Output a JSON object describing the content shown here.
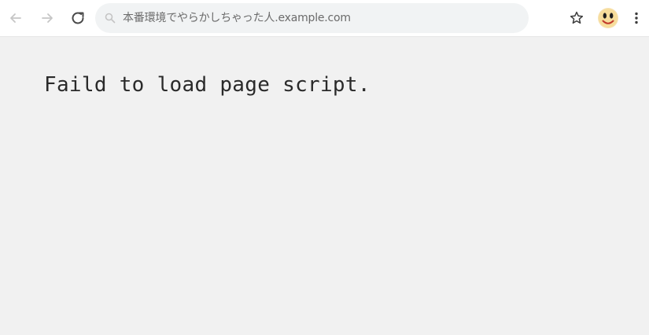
{
  "toolbar": {
    "back_icon": "arrow-left-icon",
    "forward_icon": "arrow-right-icon",
    "reload_icon": "reload-icon",
    "address": {
      "url": "本番環境でやらかしちゃった人.example.com",
      "icon": "search-icon"
    },
    "bookmark_icon": "star-outline-icon",
    "profile_icon": "smiley-avatar-icon",
    "menu_icon": "vertical-dots-icon"
  },
  "page": {
    "error_message": "Faild to load page script."
  },
  "colors": {
    "toolbar_bg": "#ffffff",
    "omnibox_bg": "#f1f3f4",
    "page_bg": "#f1f1f1",
    "text": "#2a2a2a",
    "avatar": "#f7d26b"
  }
}
